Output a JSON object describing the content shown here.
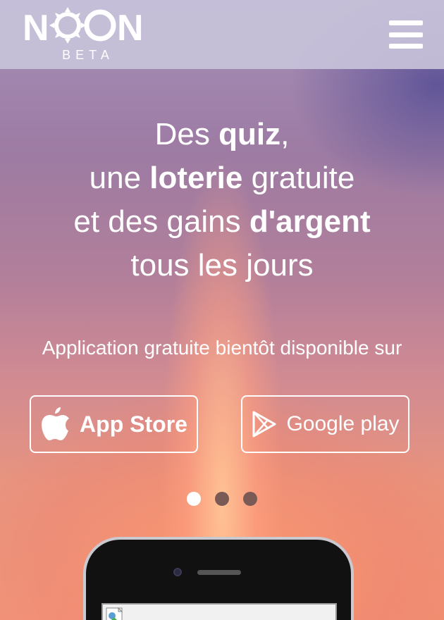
{
  "header": {
    "logo_text": "NOON",
    "logo_sub": "BETA",
    "menu_icon": "hamburger-icon"
  },
  "hero": {
    "line1": {
      "pre": "Des ",
      "bold": "quiz",
      "post": ","
    },
    "line2": {
      "pre": "une ",
      "bold": "loterie",
      "post": " gratuite"
    },
    "line3": {
      "pre": "et des gains ",
      "bold": "d'argent",
      "post": ""
    },
    "line4": "tous les jours",
    "subtitle": "Application gratuite bientôt disponible sur"
  },
  "stores": {
    "app_store": {
      "label": "App Store",
      "icon": "apple-icon"
    },
    "google_play": {
      "label": "Google play",
      "icon": "play-icon"
    }
  },
  "carousel": {
    "count": 3,
    "active": 1
  },
  "colors": {
    "header_bg": "#c8c2da",
    "text": "#ffffff",
    "dot_inactive": "#7a5a55",
    "dot_active": "#ffffff"
  }
}
